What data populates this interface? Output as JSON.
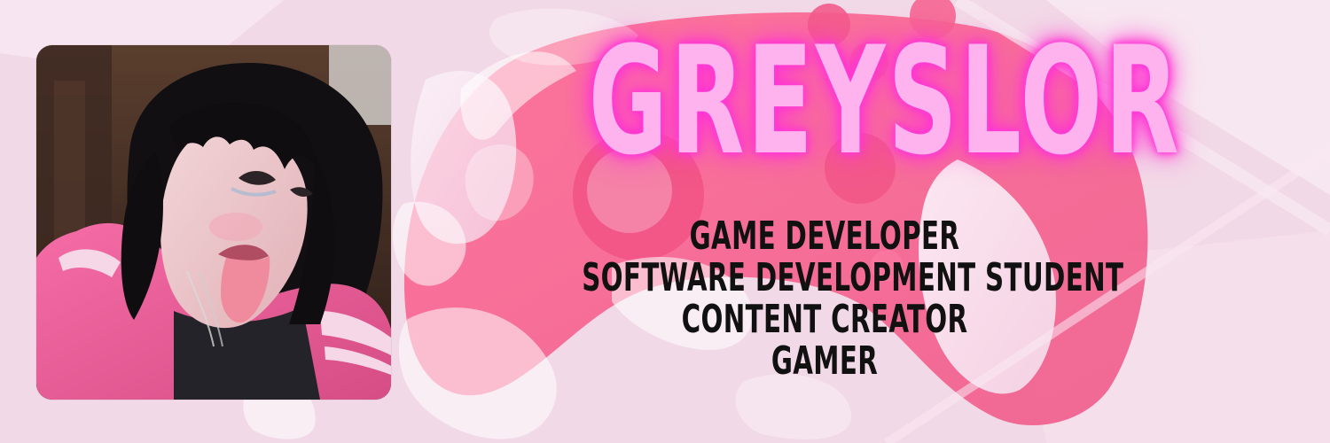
{
  "banner": {
    "title": "GREYSLOR",
    "roles": [
      "GAME DEVELOPER",
      "SOFTWARE DEVELOPMENT STUDENT",
      "CONTENT CREATOR",
      "GAMER"
    ]
  },
  "colors": {
    "title_fill": "#ffb3ee",
    "title_glow": "#ff2ecf",
    "role_text": "#111111",
    "background": "#f1dbe8",
    "accent_pink": "#f26b95"
  },
  "icons": {
    "background_art": "game-controller-splash-illustration",
    "profile_photo": "profile-photo"
  }
}
